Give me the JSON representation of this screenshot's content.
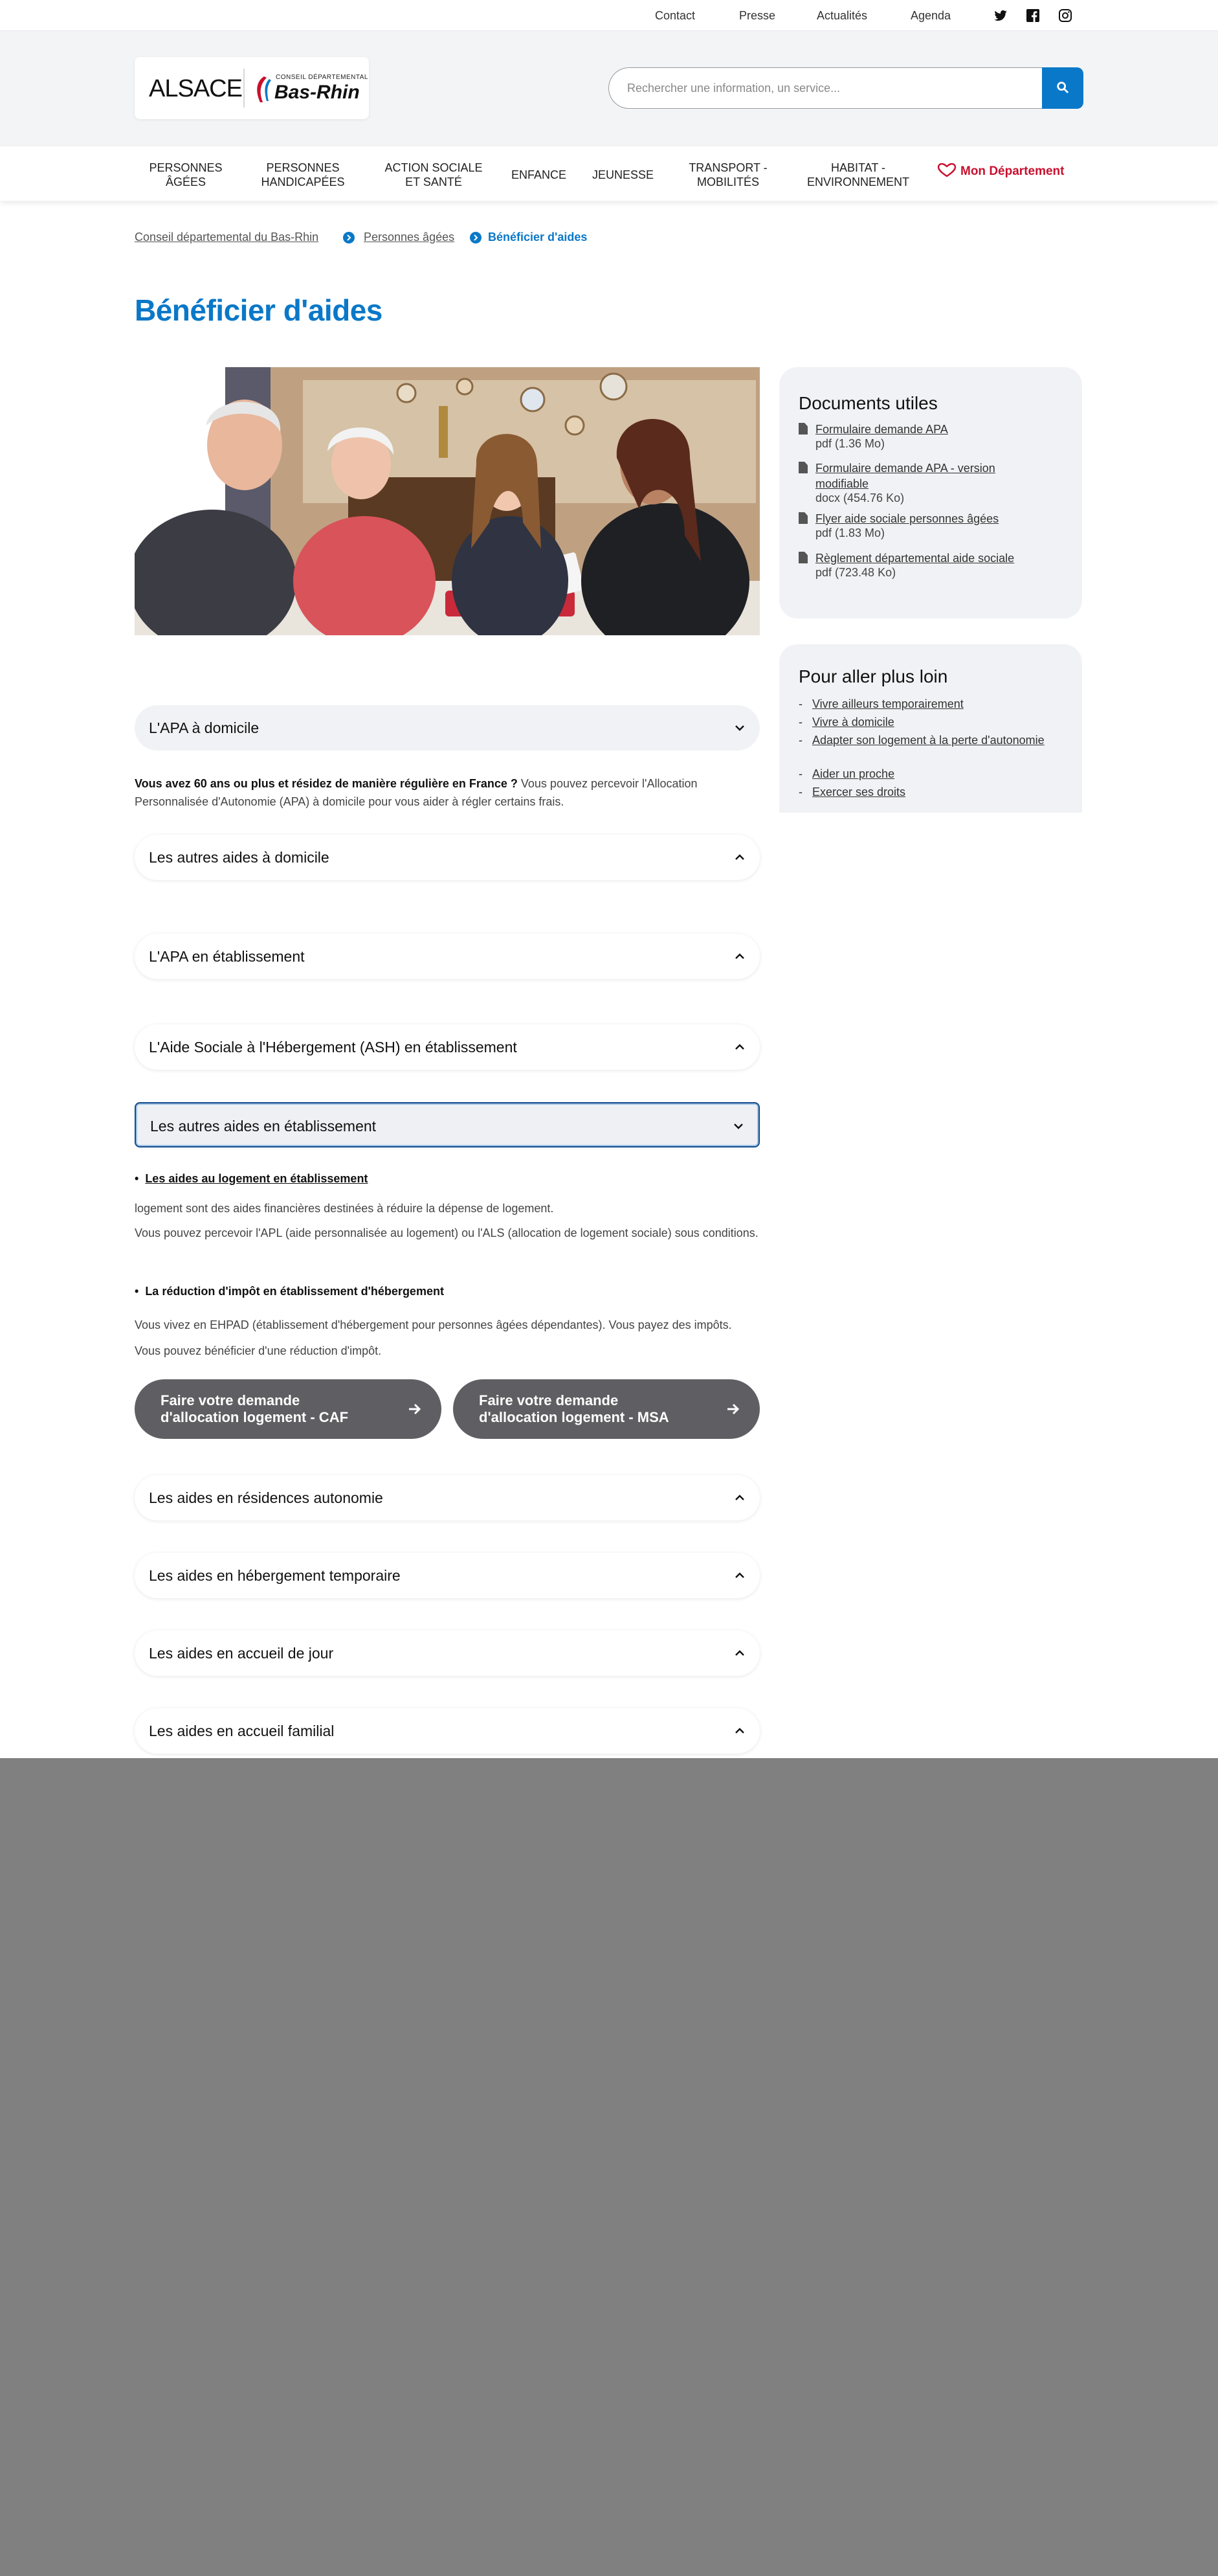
{
  "topbar": {
    "links": [
      "Contact",
      "Presse",
      "Actualités",
      "Agenda"
    ],
    "social": [
      "twitter-icon",
      "facebook-icon",
      "instagram-icon"
    ]
  },
  "header": {
    "logo_left": "ALSACE",
    "logo_small": "CONSEIL DÉPARTEMENTAL",
    "logo_right": "Bas-Rhin",
    "search_placeholder": "Rechercher une information, un service...",
    "search_icon": "search-icon"
  },
  "nav": {
    "items": [
      [
        "PERSONNES",
        "ÂGÉES"
      ],
      [
        "PERSONNES",
        "HANDICAPÉES"
      ],
      [
        "ACTION SOCIALE",
        "ET SANTÉ"
      ],
      [
        "ENFANCE"
      ],
      [
        "JEUNESSE"
      ],
      [
        "TRANSPORT -",
        "MOBILITÉS"
      ],
      [
        "HABITAT -",
        "ENVIRONNEMENT"
      ]
    ],
    "mon_departement": "Mon Département"
  },
  "breadcrumb": {
    "items": [
      "Conseil départemental du Bas-Rhin",
      "Personnes âgées"
    ],
    "current": "Bénéficier d'aides"
  },
  "page_title": "Bénéficier d'aides",
  "documents": {
    "title": "Documents utiles",
    "items": [
      {
        "label": "Formulaire demande APA",
        "meta": "pdf (1.36 Mo)"
      },
      {
        "label": "Formulaire demande APA - version modifiable",
        "meta": "docx (454.76 Ko)"
      },
      {
        "label": "Flyer aide sociale personnes âgées",
        "meta": "pdf (1.83 Mo)"
      },
      {
        "label": "Règlement départemental aide sociale",
        "meta": "pdf (723.48 Ko)"
      }
    ]
  },
  "further": {
    "title": "Pour aller plus loin",
    "items": [
      "Vivre ailleurs temporairement",
      "Vivre à domicile",
      "Adapter son logement à la perte d'autonomie",
      "Aider un proche",
      "Exercer ses droits"
    ]
  },
  "accordions": {
    "apa_domicile": "L'APA à domicile",
    "autres_domicile": "Les autres aides à domicile",
    "apa_etab": "L'APA en établissement",
    "ash": "L'Aide Sociale à l'Hébergement (ASH) en établissement",
    "autres_etab": "Les autres aides en établissement",
    "residences": "Les aides en résidences autonomie",
    "temporaire": "Les aides en hébergement temporaire",
    "jour": "Les aides en accueil de jour",
    "familial": "Les aides en accueil familial"
  },
  "apa_text": {
    "bold": "Vous avez 60 ans ou plus et résidez de manière régulière en France ?",
    "rest": " Vous pouvez percevoir l'Allocation Personnalisée d'Autonomie (APA) à domicile pour vous aider à régler certains frais."
  },
  "etab_content": {
    "bullet1": "Les aides au logement en établissement",
    "p1a": "logement sont des aides financières destinées à réduire la dépense de logement.",
    "p1b": "Vous pouvez percevoir l'APL (aide personnalisée au logement) ou l'ALS (allocation de logement sociale) sous conditions.",
    "bullet2": "La réduction d'impôt en établissement d'hébergement",
    "p2": "Vous vivez en EHPAD (établissement d'hébergement pour personnes âgées dépendantes). Vous payez des impôts. Vous pouvez bénéficier d'une réduction d'impôt."
  },
  "buttons": {
    "caf": "Faire votre demande d'allocation logement - CAF",
    "msa": "Faire votre demande d'allocation logement - MSA"
  },
  "colors": {
    "primary": "#0a78c8",
    "accent_red": "#c8102e",
    "button_grey": "#5f5f63",
    "card_bg": "#f1f2f5"
  }
}
